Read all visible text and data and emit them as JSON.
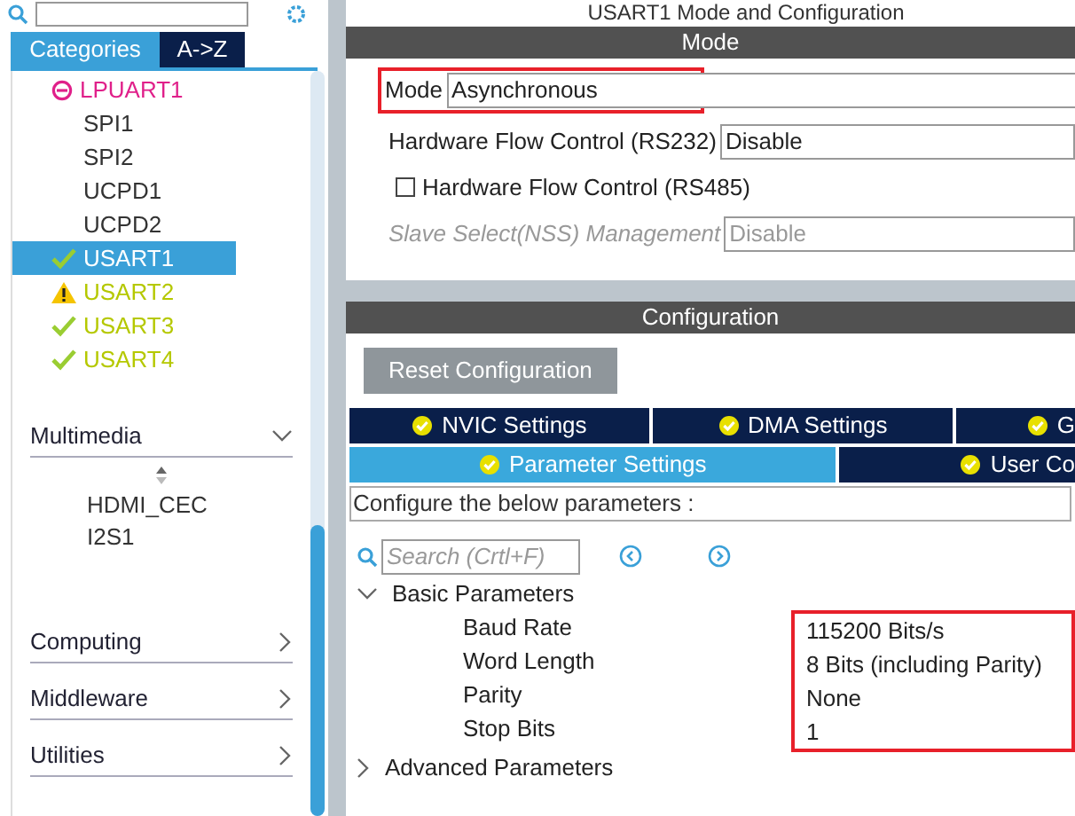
{
  "view_tabs": [
    {
      "label": "Categories",
      "selected": true
    },
    {
      "label": "A->Z",
      "selected": false
    }
  ],
  "peripherals": [
    {
      "label": "LPUART1",
      "kind": "error",
      "selected": false
    },
    {
      "label": "SPI1",
      "kind": "plain",
      "selected": false
    },
    {
      "label": "SPI2",
      "kind": "plain",
      "selected": false
    },
    {
      "label": "UCPD1",
      "kind": "plain",
      "selected": false
    },
    {
      "label": "UCPD2",
      "kind": "plain",
      "selected": false
    },
    {
      "label": "USART1",
      "kind": "ok",
      "selected": true
    },
    {
      "label": "USART2",
      "kind": "warning",
      "selected": false
    },
    {
      "label": "USART3",
      "kind": "ok",
      "selected": false
    },
    {
      "label": "USART4",
      "kind": "ok",
      "selected": false
    }
  ],
  "categories": [
    {
      "label": "Multimedia",
      "expanded": true,
      "children": [
        {
          "label": "HDMI_CEC"
        },
        {
          "label": "I2S1"
        }
      ]
    },
    {
      "label": "Computing",
      "expanded": false
    },
    {
      "label": "Middleware",
      "expanded": false
    },
    {
      "label": "Utilities",
      "expanded": false
    }
  ],
  "panel_title": "USART1 Mode and Configuration",
  "mode": {
    "header": "Mode",
    "mode_field": {
      "label": "Mode",
      "value": "Asynchronous"
    },
    "flow_rs232": {
      "label": "Hardware Flow Control (RS232)",
      "value": "Disable"
    },
    "flow_rs485": {
      "label": "Hardware Flow Control (RS485)",
      "checked": false
    },
    "nss": {
      "label": "Slave Select(NSS) Management",
      "value": "Disable",
      "disabled": true
    }
  },
  "configuration": {
    "header": "Configuration",
    "reset_button": "Reset Configuration",
    "tab_rows": [
      [
        {
          "label": "NVIC Settings",
          "selected": false
        },
        {
          "label": "DMA Settings",
          "selected": false
        },
        {
          "label": "G",
          "selected": false
        }
      ],
      [
        {
          "label": "Parameter Settings",
          "selected": true
        },
        {
          "label": "User Co",
          "selected": false
        }
      ]
    ],
    "hint": "Configure the below parameters :",
    "search_placeholder": "Search (Crtl+F)",
    "groups": [
      {
        "label": "Basic Parameters",
        "expanded": true,
        "children": [
          {
            "name": "Baud Rate",
            "value": "115200 Bits/s"
          },
          {
            "name": "Word Length",
            "value": "8 Bits (including Parity)"
          },
          {
            "name": "Parity",
            "value": "None"
          },
          {
            "name": "Stop Bits",
            "value": "1"
          }
        ]
      },
      {
        "label": "Advanced Parameters",
        "expanded": false
      }
    ]
  }
}
